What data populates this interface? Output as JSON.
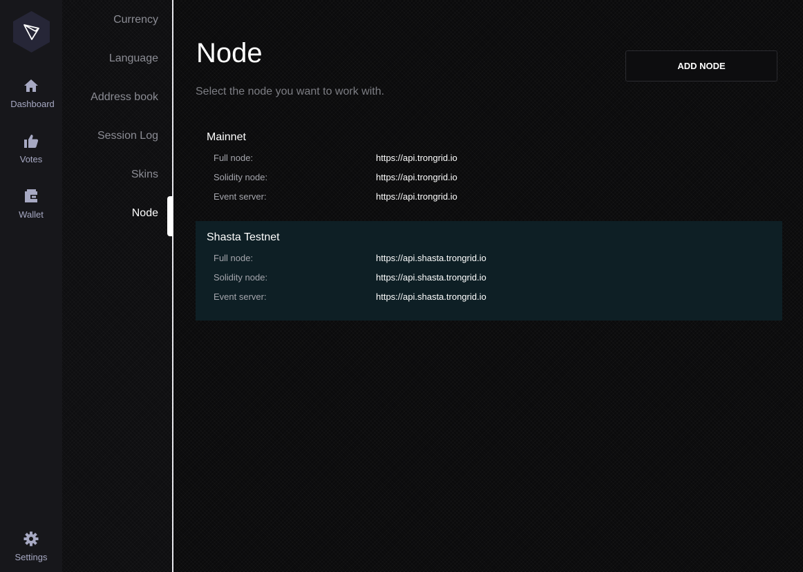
{
  "rail": {
    "items": [
      {
        "label": "Dashboard",
        "icon": "home-icon"
      },
      {
        "label": "Votes",
        "icon": "thumbs-up-icon"
      },
      {
        "label": "Wallet",
        "icon": "wallet-icon"
      }
    ],
    "settings_label": "Settings",
    "icon_color": "#a7a9c3"
  },
  "submenu": {
    "items": [
      {
        "label": "Currency"
      },
      {
        "label": "Language"
      },
      {
        "label": "Address book"
      },
      {
        "label": "Session Log"
      },
      {
        "label": "Skins"
      },
      {
        "label": "Node"
      }
    ],
    "active": "Node"
  },
  "main": {
    "title": "Node",
    "subtitle": "Select the node you want to work with.",
    "add_button_label": "ADD NODE",
    "selected_node": "Shasta Testnet",
    "nodes": [
      {
        "name": "Mainnet",
        "rows": [
          {
            "key": "Full node:",
            "value": "https://api.trongrid.io"
          },
          {
            "key": "Solidity node:",
            "value": "https://api.trongrid.io"
          },
          {
            "key": "Event server:",
            "value": "https://api.trongrid.io"
          }
        ]
      },
      {
        "name": "Shasta Testnet",
        "rows": [
          {
            "key": "Full node:",
            "value": "https://api.shasta.trongrid.io"
          },
          {
            "key": "Solidity node:",
            "value": "https://api.shasta.trongrid.io"
          },
          {
            "key": "Event server:",
            "value": "https://api.shasta.trongrid.io"
          }
        ]
      }
    ]
  },
  "colors": {
    "rail_bg": "#17171b",
    "selected_card_bg": "#0e1f25",
    "accent_white": "#ffffff"
  }
}
